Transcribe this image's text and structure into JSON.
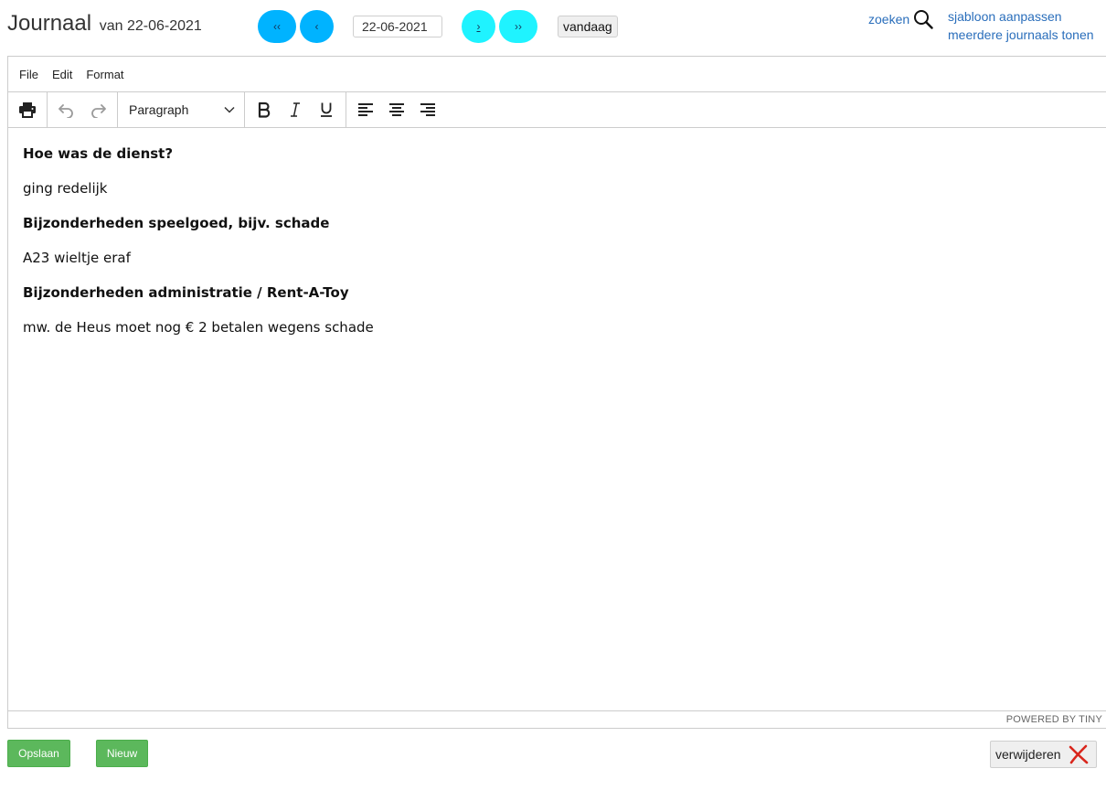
{
  "header": {
    "title": "Journaal",
    "subtitle": "van 22-06-2021",
    "nav": {
      "first_label": "‹‹",
      "prev_label": "‹",
      "next_label": "›",
      "last_label": "››"
    },
    "date_value": "22-06-2021",
    "today_label": "vandaag",
    "search_label": "zoeken",
    "template_link": "sjabloon aanpassen",
    "multi_link": "meerdere journaals tonen"
  },
  "editor": {
    "menu": [
      "File",
      "Edit",
      "Format"
    ],
    "block_format": "Paragraph",
    "content": [
      {
        "text": "Hoe was de dienst?",
        "bold": true
      },
      {
        "text": "ging redelijk",
        "bold": false
      },
      {
        "text": "Bijzonderheden speelgoed, bijv. schade",
        "bold": true
      },
      {
        "text": "A23 wieltje eraf",
        "bold": false
      },
      {
        "text": "Bijzonderheden administratie / Rent-A-Toy",
        "bold": true
      },
      {
        "text": "mw. de Heus moet nog € 2 betalen wegens schade",
        "bold": false
      }
    ],
    "statusbar": "POWERED BY TINY"
  },
  "actions": {
    "save_label": "Opslaan",
    "new_label": "Nieuw",
    "delete_label": "verwijderen"
  },
  "colors": {
    "nav_back": "#00b3ff",
    "nav_forward": "#1ff3ff",
    "link": "#2a6ebb",
    "green": "#5cb85c",
    "delete_x": "#d9261c"
  },
  "icons": [
    "search-icon",
    "print-icon",
    "undo-icon",
    "redo-icon",
    "chevron-down-icon",
    "bold-icon",
    "italic-icon",
    "underline-icon",
    "align-left-icon",
    "align-center-icon",
    "align-right-icon",
    "resize-handle-icon",
    "delete-x-icon"
  ]
}
